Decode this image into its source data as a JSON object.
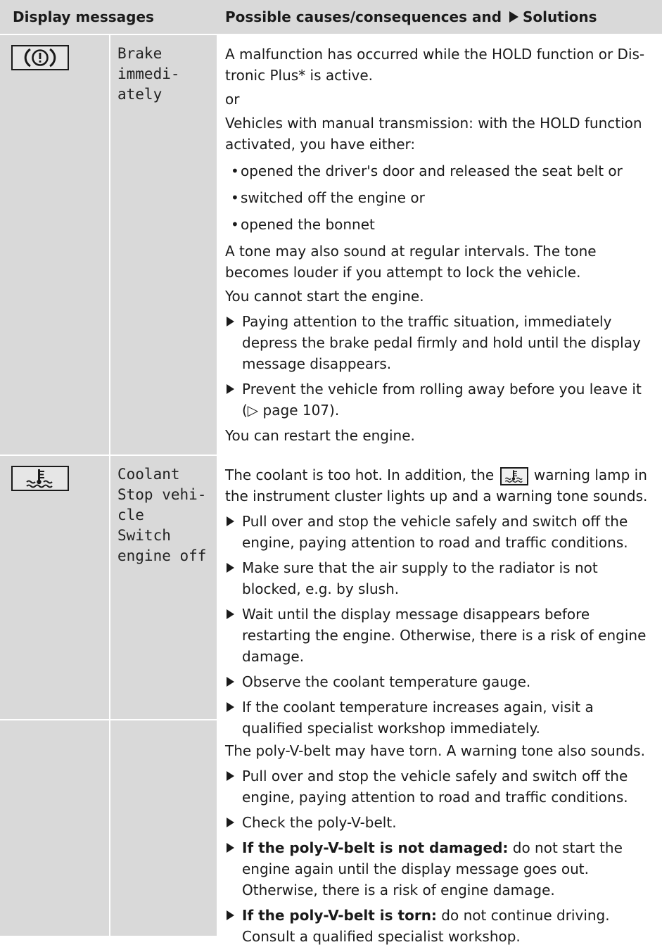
{
  "header": {
    "col1": "Display messages",
    "col2": "Possible causes/consequences and",
    "col2_solutions": "Solutions"
  },
  "rows": [
    {
      "message": "Brake\nimmedi-\nately",
      "icon": "brake-warning-icon",
      "cause1": "A malfunction has occurred while the HOLD function or Dis-tronic Plus* is active.",
      "or": "or",
      "cause2": "Vehicles with manual transmission: with the HOLD function activated, you have either:",
      "bullets": [
        "opened the driver's door and released the seat belt or",
        "switched off the engine or",
        "opened the bonnet"
      ],
      "tone": "A tone may also sound at regular intervals. The tone becomes louder if you attempt to lock the vehicle.",
      "nostart": "You cannot start the engine.",
      "actions": [
        "Paying attention to the traffic situation, immediately depress the brake pedal firmly and hold until the display message disappears.",
        "Prevent the vehicle from rolling away before you leave it (▷ page 107)."
      ],
      "restart": "You can restart the engine."
    },
    {
      "message": "Coolant\nStop vehi-\ncle\nSwitch\nengine off",
      "icon": "coolant-temperature-icon",
      "cause_a": "The coolant is too hot. In addition, the",
      "cause_b": "warning lamp in the instrument cluster lights up and a warning tone sounds.",
      "actions": [
        "Pull over and stop the vehicle safely and switch off the engine, paying attention to road and traffic conditions.",
        "Make sure that the air supply to the radiator is not blocked, e.g. by slush.",
        "Wait until the display message disappears before restarting the engine. Otherwise, there is a risk of engine damage.",
        "Observe the coolant temperature gauge.",
        "If the coolant temperature increases again, visit a qualified specialist workshop immediately."
      ]
    },
    {
      "cause": "The poly-V-belt may have torn. A warning tone also sounds.",
      "actions": [
        "Pull over and stop the vehicle safely and switch off the engine, paying attention to road and traffic conditions.",
        "Check the poly-V-belt."
      ],
      "bold_actions": [
        {
          "bold": "If the poly-V-belt is not damaged:",
          "rest": " do not start the engine again until the display message goes out. Otherwise, there is a risk of engine damage."
        },
        {
          "bold": "If the poly-V-belt is torn:",
          "rest": " do not continue driving. Consult a qualified specialist workshop."
        }
      ]
    }
  ]
}
